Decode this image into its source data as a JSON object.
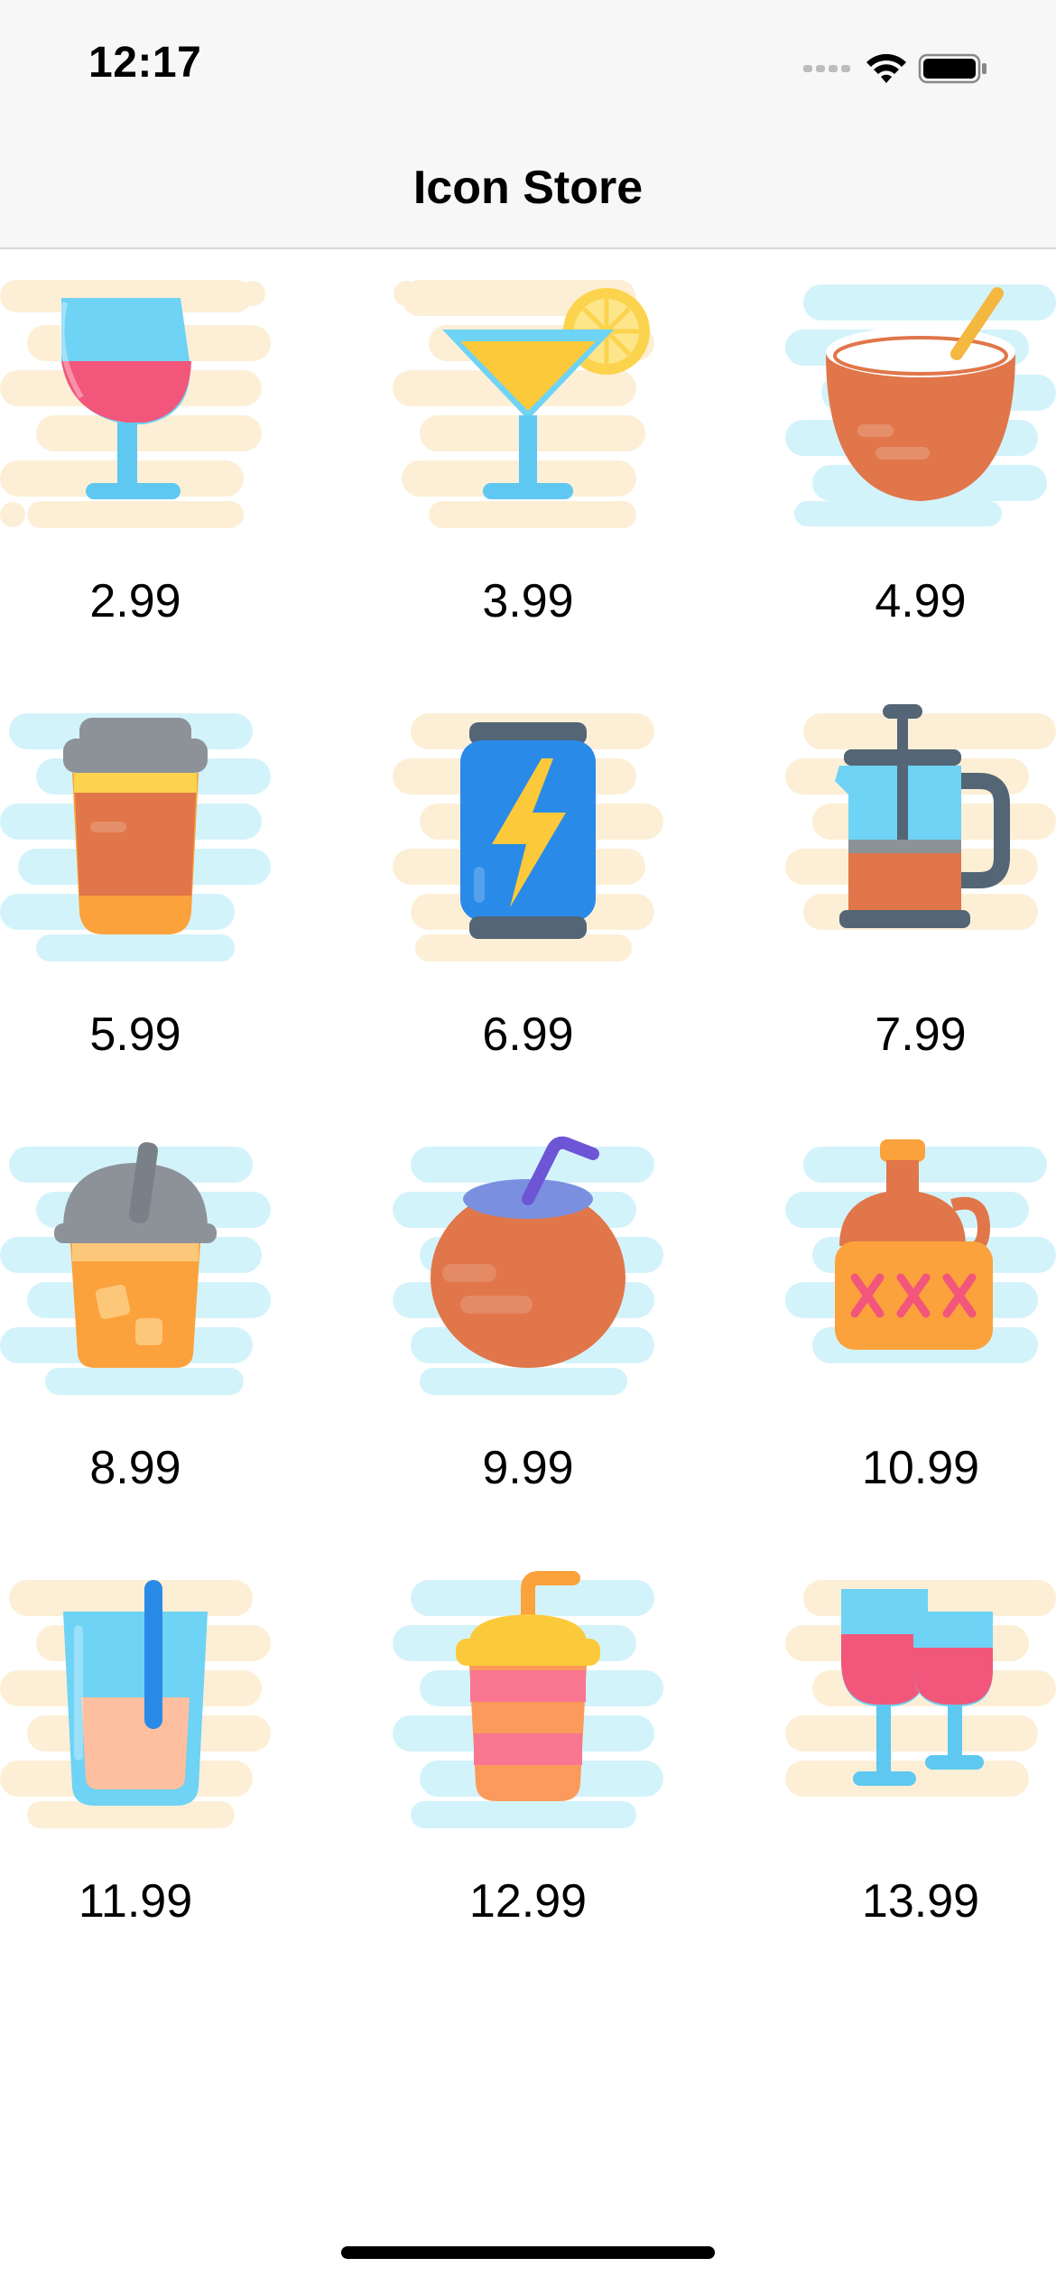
{
  "status_bar": {
    "time": "12:17",
    "icons": [
      "signal-dots-icon",
      "wifi-icon",
      "battery-icon"
    ]
  },
  "nav": {
    "title": "Icon Store"
  },
  "items": [
    {
      "icon": "wine-glass-icon",
      "price": "2.99"
    },
    {
      "icon": "cocktail-icon",
      "price": "3.99"
    },
    {
      "icon": "coconut-bowl-icon",
      "price": "4.99"
    },
    {
      "icon": "coffee-cup-icon",
      "price": "5.99"
    },
    {
      "icon": "energy-drink-can-icon",
      "price": "6.99"
    },
    {
      "icon": "french-press-icon",
      "price": "7.99"
    },
    {
      "icon": "iced-drink-icon",
      "price": "8.99"
    },
    {
      "icon": "coconut-drink-icon",
      "price": "9.99"
    },
    {
      "icon": "moonshine-jug-icon",
      "price": "10.99"
    },
    {
      "icon": "glass-with-straw-icon",
      "price": "11.99"
    },
    {
      "icon": "soda-cup-icon",
      "price": "12.99"
    },
    {
      "icon": "two-wine-glasses-icon",
      "price": "13.99"
    }
  ],
  "colors": {
    "background_yellow": "#fcefd6",
    "background_blue": "#d3f3fb",
    "accent_orange": "#e0764a",
    "accent_blue": "#5ec8f0",
    "accent_pink": "#f2567b"
  }
}
